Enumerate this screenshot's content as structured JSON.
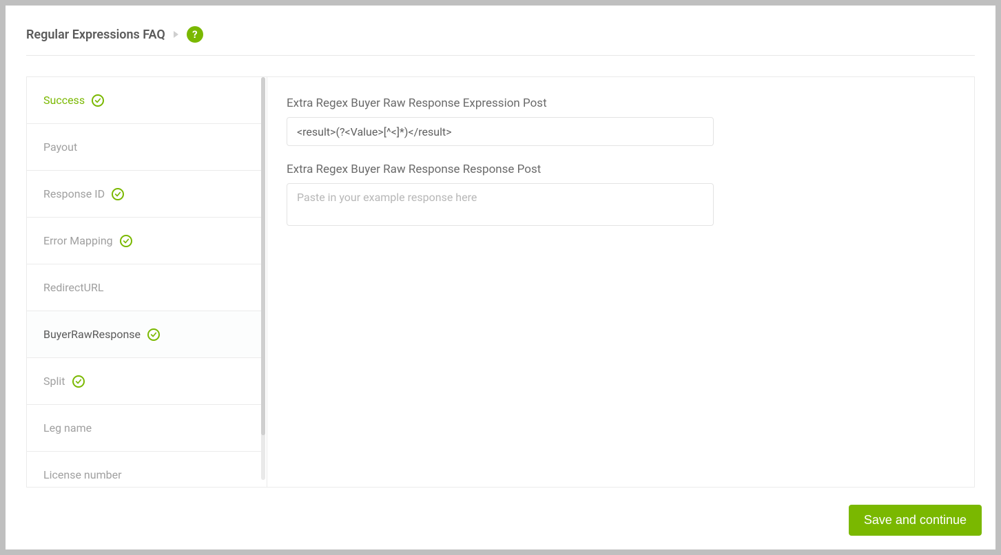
{
  "header": {
    "title": "Regular Expressions FAQ",
    "help_symbol": "?"
  },
  "sidebar": {
    "items": [
      {
        "label": "Success",
        "has_check": true,
        "active": true,
        "selected": false
      },
      {
        "label": "Payout",
        "has_check": false,
        "active": false,
        "selected": false
      },
      {
        "label": "Response ID",
        "has_check": true,
        "active": false,
        "selected": false
      },
      {
        "label": "Error Mapping",
        "has_check": true,
        "active": false,
        "selected": false
      },
      {
        "label": "RedirectURL",
        "has_check": false,
        "active": false,
        "selected": false
      },
      {
        "label": "BuyerRawResponse",
        "has_check": true,
        "active": false,
        "selected": true
      },
      {
        "label": "Split",
        "has_check": true,
        "active": false,
        "selected": false
      },
      {
        "label": "Leg name",
        "has_check": false,
        "active": false,
        "selected": false
      },
      {
        "label": "License number",
        "has_check": false,
        "active": false,
        "selected": false
      }
    ]
  },
  "main": {
    "expression_label": "Extra Regex Buyer Raw Response Expression Post",
    "expression_value": "<result>(?<Value>[^<]*)</result>",
    "response_label": "Extra Regex Buyer Raw Response Response Post",
    "response_placeholder": "Paste in your example response here",
    "response_value": ""
  },
  "footer": {
    "save_label": "Save and continue"
  },
  "colors": {
    "accent": "#7ab800"
  }
}
